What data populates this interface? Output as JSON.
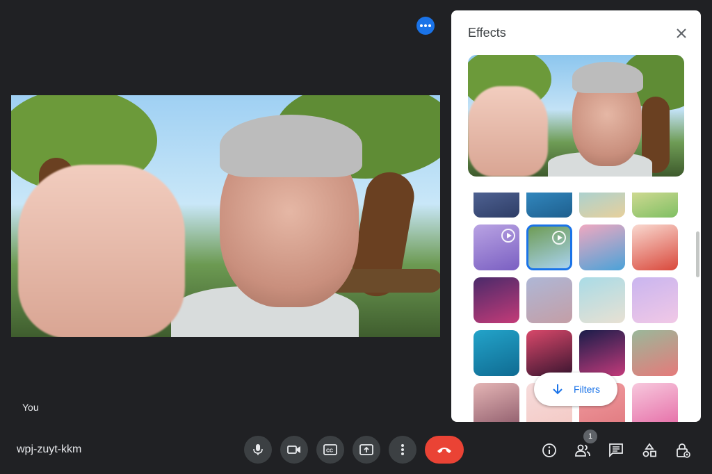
{
  "stage": {
    "self_label": "You"
  },
  "effects": {
    "title": "Effects",
    "filters_label": "Filters",
    "thumbnails": [
      {
        "name": "bus-interior",
        "c1": "#5e73a7",
        "c2": "#2e3d66",
        "video": true
      },
      {
        "name": "underwater-blue",
        "c1": "#3b9ad4",
        "c2": "#1e5f8e",
        "video": true
      },
      {
        "name": "beach-scene",
        "c1": "#8fd2e8",
        "c2": "#e7d09b",
        "video": true
      },
      {
        "name": "cactus-desert",
        "c1": "#f5e6a8",
        "c2": "#7fbf63",
        "video": true
      },
      {
        "name": "purple-room",
        "c1": "#b9a3e3",
        "c2": "#7a5fc2",
        "video": true
      },
      {
        "name": "forest-trees",
        "c1": "#6e9c55",
        "c2": "#a9d2ef",
        "video": true
      },
      {
        "name": "festive-people",
        "c1": "#f0a8c0",
        "c2": "#4aa2d8",
        "video": false
      },
      {
        "name": "red-dragon",
        "c1": "#f9d9d0",
        "c2": "#d9483b",
        "video": false
      },
      {
        "name": "party-stage",
        "c1": "#4a2a6a",
        "c2": "#c43b78",
        "video": false
      },
      {
        "name": "dusk-gradient",
        "c1": "#aeb7d6",
        "c2": "#c49ea6",
        "video": false
      },
      {
        "name": "calm-beach",
        "c1": "#a9dbe6",
        "c2": "#e8e1d3",
        "video": false
      },
      {
        "name": "pink-clouds",
        "c1": "#c9b5ef",
        "c2": "#f1c8e6",
        "video": false
      },
      {
        "name": "water-ripples",
        "c1": "#23a3c9",
        "c2": "#0f6b92",
        "video": false
      },
      {
        "name": "red-nebula",
        "c1": "#d8486a",
        "c2": "#3a1530",
        "video": false
      },
      {
        "name": "fireworks",
        "c1": "#1a1d4a",
        "c2": "#c23a7a",
        "video": false
      },
      {
        "name": "rose-garden",
        "c1": "#9ab89a",
        "c2": "#e57a7a",
        "video": false
      },
      {
        "name": "flower-field",
        "c1": "#e4b5b5",
        "c2": "#8d5a6a",
        "video": false
      },
      {
        "name": "soft-pink",
        "c1": "#f6dcdc",
        "c2": "#f4c9c4",
        "video": false
      },
      {
        "name": "pink-pattern",
        "c1": "#f29ca0",
        "c2": "#e07a80",
        "video": false
      },
      {
        "name": "pink-confetti",
        "c1": "#f7c8dd",
        "c2": "#e56aa5",
        "video": false
      }
    ]
  },
  "bottom_bar": {
    "meeting_code": "wpj-zuyt-kkm",
    "people_count": "1"
  },
  "colors": {
    "accent": "#1a73e8",
    "hangup": "#ea4335",
    "background": "#202124"
  },
  "icons": [
    "audio-level-icon",
    "close-icon",
    "mic-icon",
    "camera-icon",
    "captions-icon",
    "present-icon",
    "more-icon",
    "hangup-icon",
    "info-icon",
    "people-icon",
    "chat-icon",
    "activities-icon",
    "host-controls-icon",
    "arrow-down-icon"
  ]
}
